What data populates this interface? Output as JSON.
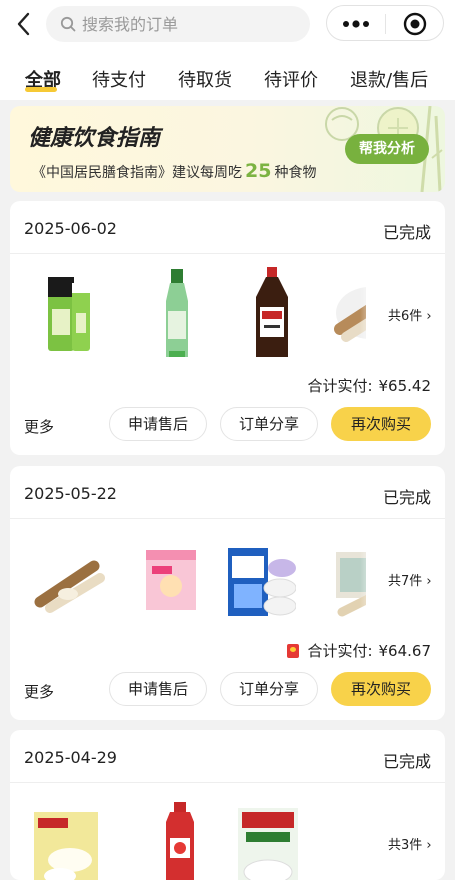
{
  "search": {
    "placeholder": "搜索我的订单"
  },
  "tabs": [
    "全部",
    "待支付",
    "待取货",
    "待评价",
    "退款/售后"
  ],
  "banner": {
    "title": "健康饮食指南",
    "sub_prefix": "《中国居民膳食指南》建议每周吃",
    "sub_number": "25",
    "sub_suffix": "种食物",
    "button": "帮我分析"
  },
  "orders": [
    {
      "date": "2025-06-02",
      "status": "已完成",
      "count": "共6件",
      "total_label": "合计实付:",
      "total": "¥65.42",
      "products": [
        "toothpaste",
        "sauce-bottle",
        "soy-sauce",
        "yam"
      ]
    },
    {
      "date": "2025-05-22",
      "status": "已完成",
      "count": "共7件",
      "total_label": "合计实付:",
      "total": "¥64.67",
      "products": [
        "yam",
        "kids-snack-box",
        "soap-pack",
        "gift-box"
      ]
    },
    {
      "date": "2025-04-29",
      "status": "已完成",
      "count": "共3件",
      "products": [
        "dumplings",
        "ketchup",
        "rice-noodles"
      ]
    }
  ],
  "actions": {
    "more": "更多",
    "after_sale": "申请售后",
    "share": "订单分享",
    "rebuy": "再次购买"
  },
  "colors": {
    "accent_yellow": "#f8d24a",
    "green": "#78b13e",
    "background": "#f2f2f2"
  }
}
